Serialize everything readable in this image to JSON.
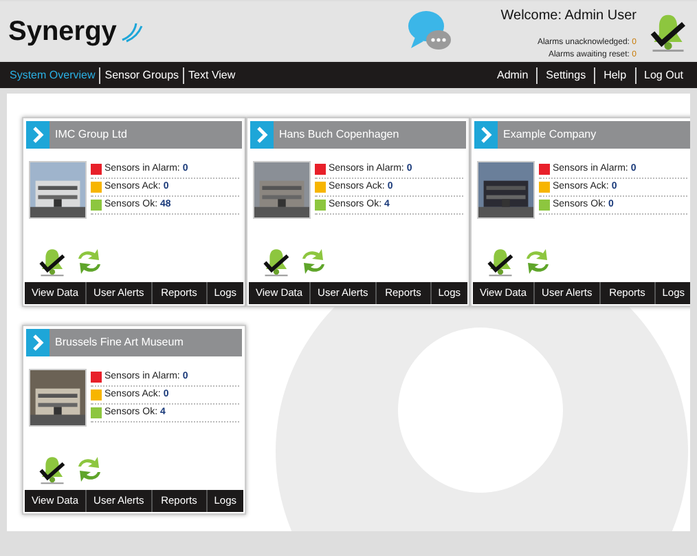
{
  "header": {
    "logo": "Synergy",
    "welcome": "Welcome: Admin User",
    "alarms": [
      {
        "label": "Alarms unacknowledged:",
        "value": "0"
      },
      {
        "label": "Alarms awaiting reset:",
        "value": "0"
      }
    ]
  },
  "nav_left": [
    {
      "label": "System Overview",
      "selected": true
    },
    {
      "label": "Sensor Groups",
      "selected": false
    },
    {
      "label": "Text View",
      "selected": false
    }
  ],
  "nav_right": [
    "Admin",
    "Settings",
    "Help",
    "Log Out"
  ],
  "sites": [
    {
      "name": "IMC Group Ltd",
      "stats": [
        {
          "label": "Sensors in Alarm:",
          "value": "0",
          "color": "#e8202a"
        },
        {
          "label": "Sensors Ack:",
          "value": "0",
          "color": "#f7b500"
        },
        {
          "label": "Sensors Ok:",
          "value": "48",
          "color": "#8dc63f"
        }
      ],
      "actions": [
        "View Data",
        "User Alerts",
        "Reports",
        "Logs"
      ]
    },
    {
      "name": "Hans Buch Copenhagen",
      "stats": [
        {
          "label": "Sensors in Alarm:",
          "value": "0",
          "color": "#e8202a"
        },
        {
          "label": "Sensors Ack:",
          "value": "0",
          "color": "#f7b500"
        },
        {
          "label": "Sensors Ok:",
          "value": "4",
          "color": "#8dc63f"
        }
      ],
      "actions": [
        "View Data",
        "User Alerts",
        "Reports",
        "Logs"
      ]
    },
    {
      "name": "Example Company",
      "stats": [
        {
          "label": "Sensors in Alarm:",
          "value": "0",
          "color": "#e8202a"
        },
        {
          "label": "Sensors Ack:",
          "value": "0",
          "color": "#f7b500"
        },
        {
          "label": "Sensors Ok:",
          "value": "0",
          "color": "#8dc63f"
        }
      ],
      "actions": [
        "View Data",
        "User Alerts",
        "Reports",
        "Logs"
      ]
    },
    {
      "name": "Brussels Fine Art Museum",
      "stats": [
        {
          "label": "Sensors in Alarm:",
          "value": "0",
          "color": "#e8202a"
        },
        {
          "label": "Sensors Ack:",
          "value": "0",
          "color": "#f7b500"
        },
        {
          "label": "Sensors Ok:",
          "value": "4",
          "color": "#8dc63f"
        }
      ],
      "actions": [
        "View Data",
        "User Alerts",
        "Reports",
        "Logs"
      ]
    }
  ]
}
